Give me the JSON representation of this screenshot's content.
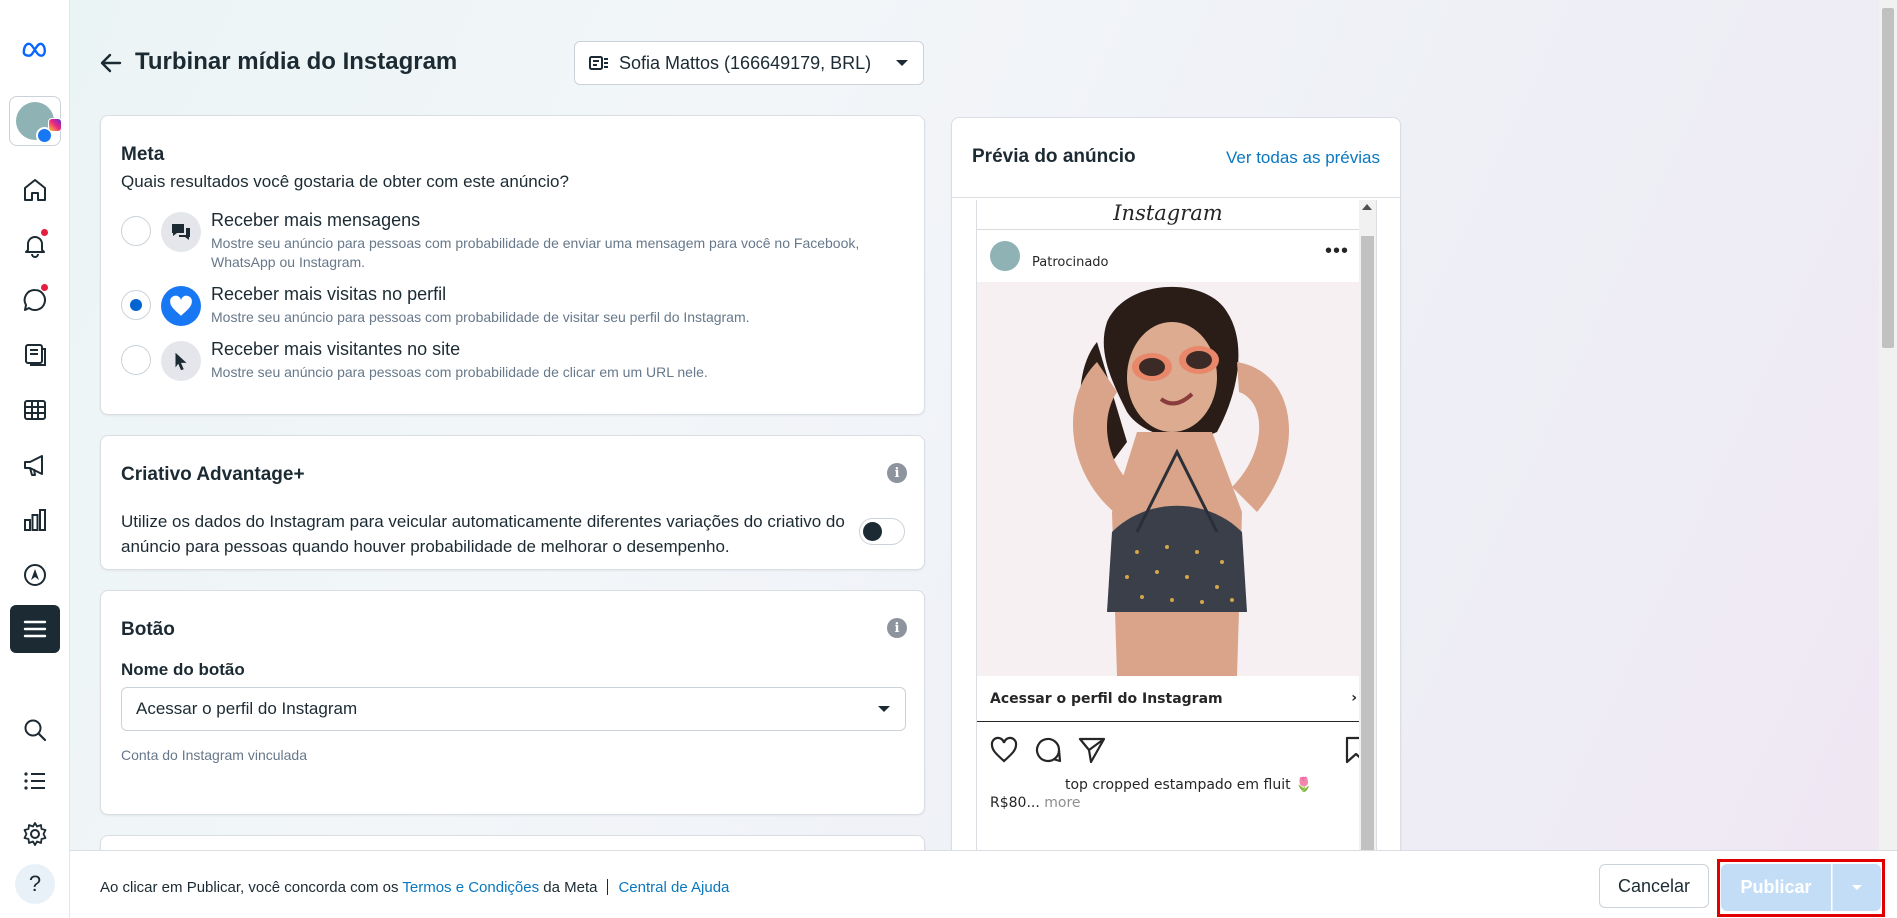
{
  "header": {
    "title": "Turbinar mídia do Instagram",
    "account": "Sofia Mattos (166649179, BRL)"
  },
  "sidebar": {
    "icons": [
      "meta-logo-icon",
      "home-icon",
      "bell-icon",
      "chat-icon",
      "pages-icon",
      "table-icon",
      "megaphone-icon",
      "bar-chart-icon",
      "compass-icon",
      "menu-icon",
      "search-icon",
      "list-icon",
      "gear-icon",
      "help-icon"
    ],
    "help_glyph": "?"
  },
  "goal": {
    "title": "Meta",
    "question": "Quais resultados você gostaria de obter com este anúncio?",
    "options": [
      {
        "label": "Receber mais mensagens",
        "desc": "Mostre seu anúncio para pessoas com probabilidade de enviar uma mensagem para você no Facebook, WhatsApp ou Instagram.",
        "selected": false
      },
      {
        "label": "Receber mais visitas no perfil",
        "desc": "Mostre seu anúncio para pessoas com probabilidade de visitar seu perfil do Instagram.",
        "selected": true
      },
      {
        "label": "Receber mais visitantes no site",
        "desc": "Mostre seu anúncio para pessoas com probabilidade de clicar em um URL nele.",
        "selected": false
      }
    ]
  },
  "advantage": {
    "title": "Criativo Advantage+",
    "text": "Utilize os dados do Instagram para veicular automaticamente diferentes variações do criativo do anúncio para pessoas quando houver probabilidade de melhorar o desempenho.",
    "enabled": false,
    "info_glyph": "i"
  },
  "button_section": {
    "title": "Botão",
    "field_label": "Nome do botão",
    "selected": "Acessar o perfil do Instagram",
    "hint": "Conta do Instagram vinculada",
    "info_glyph": "i"
  },
  "preview": {
    "title": "Prévia do anúncio",
    "see_all": "Ver todas as prévias",
    "ig_logo": "Instagram",
    "sponsored": "Patrocinado",
    "more_glyph": "•••",
    "cta": "Acessar o perfil do Instagram",
    "cta_chevron": "›",
    "caption": "top cropped estampado em fluit 🌷",
    "price": "R$80...",
    "more": "more"
  },
  "footer": {
    "text_before": "Ao clicar em Publicar, você concorda com os ",
    "terms_link": "Termos e Condições",
    "text_after": " da Meta",
    "help_link": "Central de Ajuda",
    "cancel": "Cancelar",
    "publish": "Publicar"
  },
  "colors": {
    "accent": "#0064d1",
    "link": "#0a78be",
    "publish_disabled": "#c4ddf7",
    "highlight": "#e00000"
  }
}
